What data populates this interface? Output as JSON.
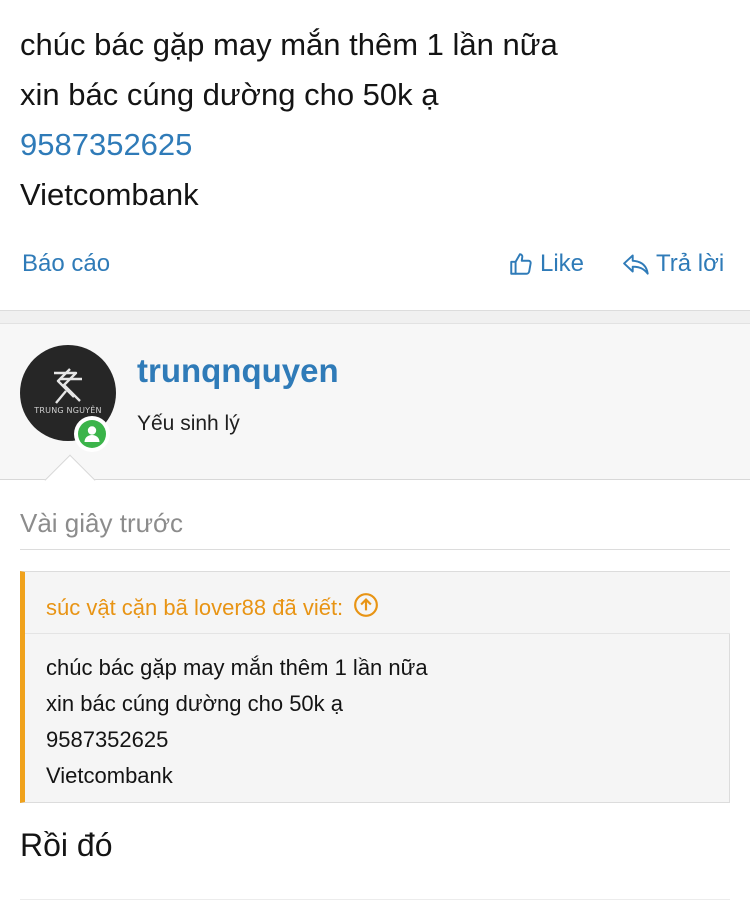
{
  "previous_post": {
    "lines": [
      "chúc bác gặp may mắn thêm 1 lần nữa",
      "xin bác cúng dường cho 50k ạ"
    ],
    "phone": "9587352625",
    "bank": "Vietcombank"
  },
  "actions": {
    "report_label": "Báo cáo",
    "like_label": "Like",
    "reply_label": "Trả lời"
  },
  "author": {
    "username": "trunqnquyen",
    "user_title": "Yếu sinh lý",
    "avatar_text": "TRUNG NGUYÊN",
    "online": true
  },
  "post": {
    "timestamp": "Vài giây trước",
    "quote": {
      "author_line": "súc vật cặn bã lover88 đã viết:",
      "lines": [
        "chúc bác gặp may mắn thêm 1 lần nữa",
        "xin bác cúng dường cho 50k ạ",
        "9587352625",
        "Vietcombank"
      ]
    },
    "reply_text": "Rồi đó"
  },
  "colors": {
    "link": "#2f7bb8",
    "quote_accent": "#f0a21c",
    "online": "#3bb44a"
  }
}
